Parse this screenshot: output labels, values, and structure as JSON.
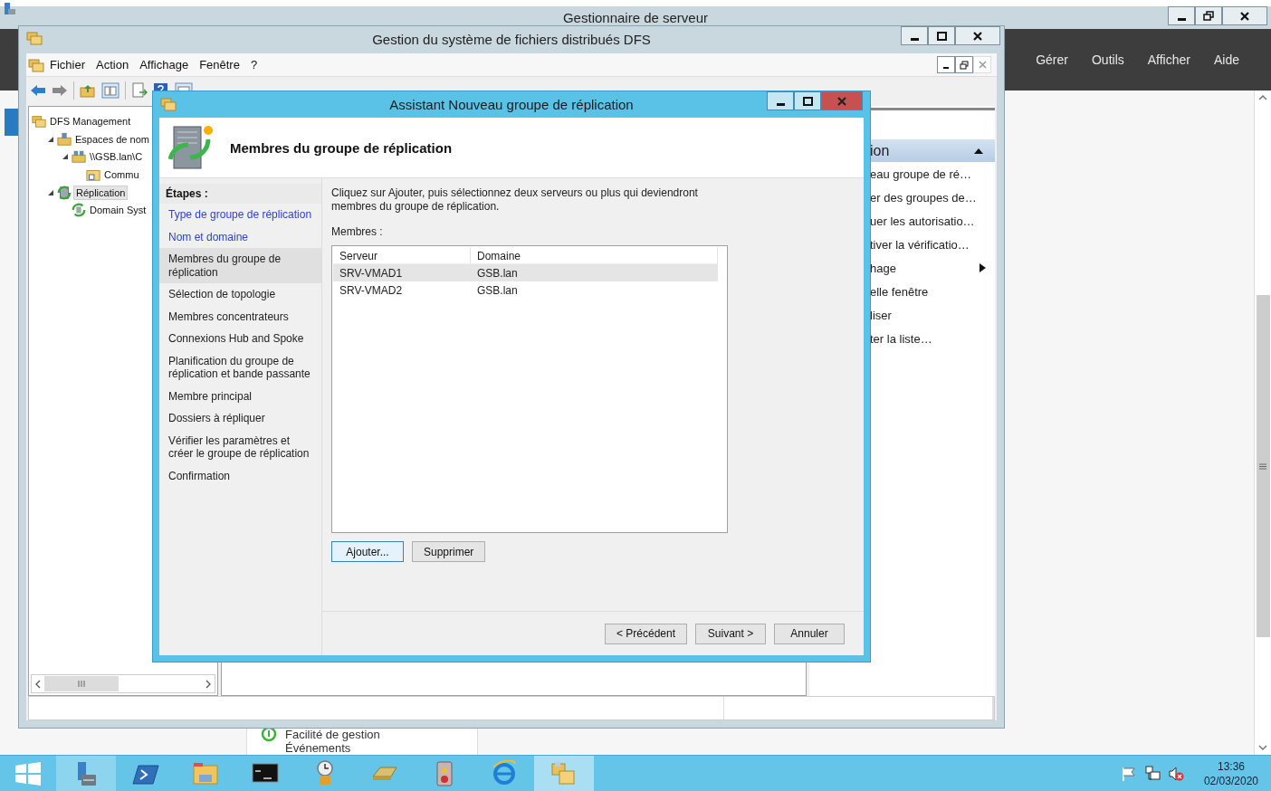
{
  "server_manager": {
    "title": "Gestionnaire de serveur",
    "menu": [
      "Gérer",
      "Outils",
      "Afficher",
      "Aide"
    ],
    "tile_items": [
      {
        "label": "Facilité de gestion",
        "kind": "ok"
      },
      {
        "label": "Événements",
        "kind": "plain"
      }
    ]
  },
  "dfs_window": {
    "title": "Gestion du système de fichiers distribués DFS",
    "menu": [
      "Fichier",
      "Action",
      "Affichage",
      "Fenêtre",
      "?"
    ],
    "tree": [
      {
        "label": "DFS Management",
        "kind": "root",
        "selected": false,
        "children": [
          {
            "label": "Espaces de nom",
            "kind": "namespaces",
            "selected": false,
            "expanded": true,
            "children": [
              {
                "label": "\\\\GSB.lan\\C",
                "kind": "namespace",
                "selected": false,
                "expanded": true,
                "children": [
                  {
                    "label": "Commu",
                    "kind": "folder",
                    "selected": false
                  }
                ]
              }
            ]
          },
          {
            "label": "Réplication",
            "kind": "replication",
            "selected": true,
            "expanded": true,
            "children": [
              {
                "label": "Domain Syst",
                "kind": "group",
                "selected": false
              }
            ]
          }
        ]
      }
    ],
    "actions": {
      "header": "ion",
      "expanded": true,
      "items": [
        {
          "label": "eau groupe de ré…",
          "submenu": false
        },
        {
          "label": "er des groupes de…",
          "submenu": false
        },
        {
          "label": "uer les autorisatio…",
          "submenu": false
        },
        {
          "label": "tiver la vérificatio…",
          "submenu": false
        },
        {
          "label": "hage",
          "submenu": true
        },
        {
          "label": "elle fenêtre",
          "submenu": false
        },
        {
          "label": "liser",
          "submenu": false
        },
        {
          "label": "ter la liste…",
          "submenu": false
        }
      ]
    }
  },
  "wizard": {
    "title": "Assistant Nouveau groupe de réplication",
    "page_title": "Membres du groupe de réplication",
    "steps_heading": "Étapes :",
    "steps": [
      {
        "label": "Type de groupe de réplication",
        "done": true,
        "selected": false
      },
      {
        "label": "Nom et domaine",
        "done": true,
        "selected": false
      },
      {
        "label": "Membres du groupe de réplication",
        "done": false,
        "selected": true
      },
      {
        "label": "Sélection de topologie",
        "done": false,
        "selected": false
      },
      {
        "label": "Membres concentrateurs",
        "done": false,
        "selected": false
      },
      {
        "label": "Connexions Hub and Spoke",
        "done": false,
        "selected": false
      },
      {
        "label": "Planification du groupe de réplication et bande passante",
        "done": false,
        "selected": false
      },
      {
        "label": "Membre principal",
        "done": false,
        "selected": false
      },
      {
        "label": "Dossiers à répliquer",
        "done": false,
        "selected": false
      },
      {
        "label": "Vérifier les paramètres et créer le groupe de réplication",
        "done": false,
        "selected": false
      },
      {
        "label": "Confirmation",
        "done": false,
        "selected": false
      }
    ],
    "instructions": "Cliquez sur Ajouter, puis sélectionnez deux serveurs ou plus qui deviendront membres du groupe de réplication.",
    "members_label": "Membres :",
    "columns": [
      "Serveur",
      "Domaine"
    ],
    "rows": [
      {
        "cells": [
          "SRV-VMAD1",
          "GSB.lan"
        ],
        "selected": true
      },
      {
        "cells": [
          "SRV-VMAD2",
          "GSB.lan"
        ],
        "selected": false
      }
    ],
    "list_buttons": [
      {
        "label": "Ajouter...",
        "focused": true
      },
      {
        "label": "Supprimer",
        "focused": false
      }
    ],
    "nav_buttons": [
      {
        "label": "< Précédent",
        "focused": false
      },
      {
        "label": "Suivant >",
        "focused": false
      },
      {
        "label": "Annuler",
        "focused": false
      }
    ]
  },
  "taskbar": {
    "apps": [
      {
        "kind": "server-manager",
        "selected": false,
        "running": true
      },
      {
        "kind": "powershell",
        "selected": false,
        "running": false
      },
      {
        "kind": "explorer",
        "selected": false,
        "running": false
      },
      {
        "kind": "cmd",
        "selected": false,
        "running": false
      },
      {
        "kind": "scheduler",
        "selected": false,
        "running": false
      },
      {
        "kind": "drive",
        "selected": false,
        "running": false
      },
      {
        "kind": "event",
        "selected": false,
        "running": false
      },
      {
        "kind": "ie",
        "selected": false,
        "running": false
      },
      {
        "kind": "dfs",
        "selected": true,
        "running": true
      }
    ],
    "time": "13:36",
    "date": "02/03/2020"
  }
}
